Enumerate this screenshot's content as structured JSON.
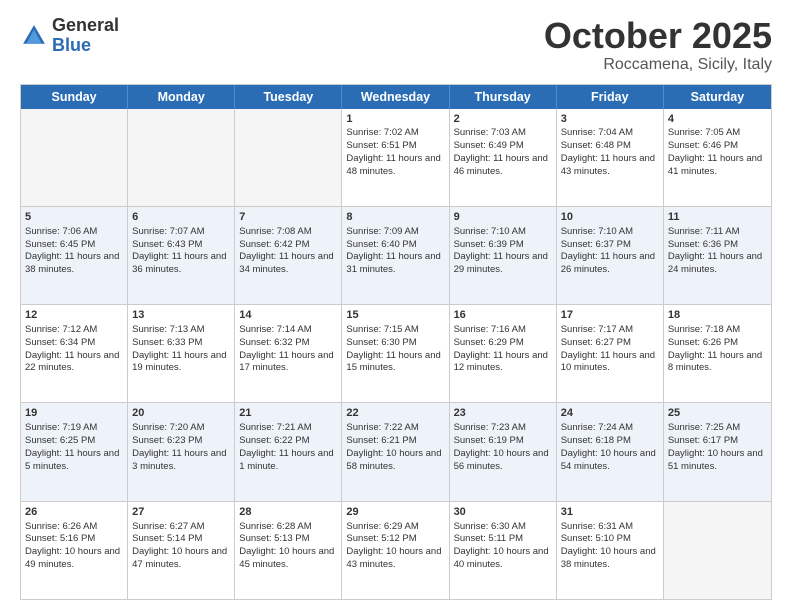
{
  "logo": {
    "general": "General",
    "blue": "Blue"
  },
  "title": "October 2025",
  "location": "Roccamena, Sicily, Italy",
  "days_of_week": [
    "Sunday",
    "Monday",
    "Tuesday",
    "Wednesday",
    "Thursday",
    "Friday",
    "Saturday"
  ],
  "weeks": [
    [
      {
        "day": "",
        "info": ""
      },
      {
        "day": "",
        "info": ""
      },
      {
        "day": "",
        "info": ""
      },
      {
        "day": "1",
        "info": "Sunrise: 7:02 AM\nSunset: 6:51 PM\nDaylight: 11 hours and 48 minutes."
      },
      {
        "day": "2",
        "info": "Sunrise: 7:03 AM\nSunset: 6:49 PM\nDaylight: 11 hours and 46 minutes."
      },
      {
        "day": "3",
        "info": "Sunrise: 7:04 AM\nSunset: 6:48 PM\nDaylight: 11 hours and 43 minutes."
      },
      {
        "day": "4",
        "info": "Sunrise: 7:05 AM\nSunset: 6:46 PM\nDaylight: 11 hours and 41 minutes."
      }
    ],
    [
      {
        "day": "5",
        "info": "Sunrise: 7:06 AM\nSunset: 6:45 PM\nDaylight: 11 hours and 38 minutes."
      },
      {
        "day": "6",
        "info": "Sunrise: 7:07 AM\nSunset: 6:43 PM\nDaylight: 11 hours and 36 minutes."
      },
      {
        "day": "7",
        "info": "Sunrise: 7:08 AM\nSunset: 6:42 PM\nDaylight: 11 hours and 34 minutes."
      },
      {
        "day": "8",
        "info": "Sunrise: 7:09 AM\nSunset: 6:40 PM\nDaylight: 11 hours and 31 minutes."
      },
      {
        "day": "9",
        "info": "Sunrise: 7:10 AM\nSunset: 6:39 PM\nDaylight: 11 hours and 29 minutes."
      },
      {
        "day": "10",
        "info": "Sunrise: 7:10 AM\nSunset: 6:37 PM\nDaylight: 11 hours and 26 minutes."
      },
      {
        "day": "11",
        "info": "Sunrise: 7:11 AM\nSunset: 6:36 PM\nDaylight: 11 hours and 24 minutes."
      }
    ],
    [
      {
        "day": "12",
        "info": "Sunrise: 7:12 AM\nSunset: 6:34 PM\nDaylight: 11 hours and 22 minutes."
      },
      {
        "day": "13",
        "info": "Sunrise: 7:13 AM\nSunset: 6:33 PM\nDaylight: 11 hours and 19 minutes."
      },
      {
        "day": "14",
        "info": "Sunrise: 7:14 AM\nSunset: 6:32 PM\nDaylight: 11 hours and 17 minutes."
      },
      {
        "day": "15",
        "info": "Sunrise: 7:15 AM\nSunset: 6:30 PM\nDaylight: 11 hours and 15 minutes."
      },
      {
        "day": "16",
        "info": "Sunrise: 7:16 AM\nSunset: 6:29 PM\nDaylight: 11 hours and 12 minutes."
      },
      {
        "day": "17",
        "info": "Sunrise: 7:17 AM\nSunset: 6:27 PM\nDaylight: 11 hours and 10 minutes."
      },
      {
        "day": "18",
        "info": "Sunrise: 7:18 AM\nSunset: 6:26 PM\nDaylight: 11 hours and 8 minutes."
      }
    ],
    [
      {
        "day": "19",
        "info": "Sunrise: 7:19 AM\nSunset: 6:25 PM\nDaylight: 11 hours and 5 minutes."
      },
      {
        "day": "20",
        "info": "Sunrise: 7:20 AM\nSunset: 6:23 PM\nDaylight: 11 hours and 3 minutes."
      },
      {
        "day": "21",
        "info": "Sunrise: 7:21 AM\nSunset: 6:22 PM\nDaylight: 11 hours and 1 minute."
      },
      {
        "day": "22",
        "info": "Sunrise: 7:22 AM\nSunset: 6:21 PM\nDaylight: 10 hours and 58 minutes."
      },
      {
        "day": "23",
        "info": "Sunrise: 7:23 AM\nSunset: 6:19 PM\nDaylight: 10 hours and 56 minutes."
      },
      {
        "day": "24",
        "info": "Sunrise: 7:24 AM\nSunset: 6:18 PM\nDaylight: 10 hours and 54 minutes."
      },
      {
        "day": "25",
        "info": "Sunrise: 7:25 AM\nSunset: 6:17 PM\nDaylight: 10 hours and 51 minutes."
      }
    ],
    [
      {
        "day": "26",
        "info": "Sunrise: 6:26 AM\nSunset: 5:16 PM\nDaylight: 10 hours and 49 minutes."
      },
      {
        "day": "27",
        "info": "Sunrise: 6:27 AM\nSunset: 5:14 PM\nDaylight: 10 hours and 47 minutes."
      },
      {
        "day": "28",
        "info": "Sunrise: 6:28 AM\nSunset: 5:13 PM\nDaylight: 10 hours and 45 minutes."
      },
      {
        "day": "29",
        "info": "Sunrise: 6:29 AM\nSunset: 5:12 PM\nDaylight: 10 hours and 43 minutes."
      },
      {
        "day": "30",
        "info": "Sunrise: 6:30 AM\nSunset: 5:11 PM\nDaylight: 10 hours and 40 minutes."
      },
      {
        "day": "31",
        "info": "Sunrise: 6:31 AM\nSunset: 5:10 PM\nDaylight: 10 hours and 38 minutes."
      },
      {
        "day": "",
        "info": ""
      }
    ]
  ]
}
